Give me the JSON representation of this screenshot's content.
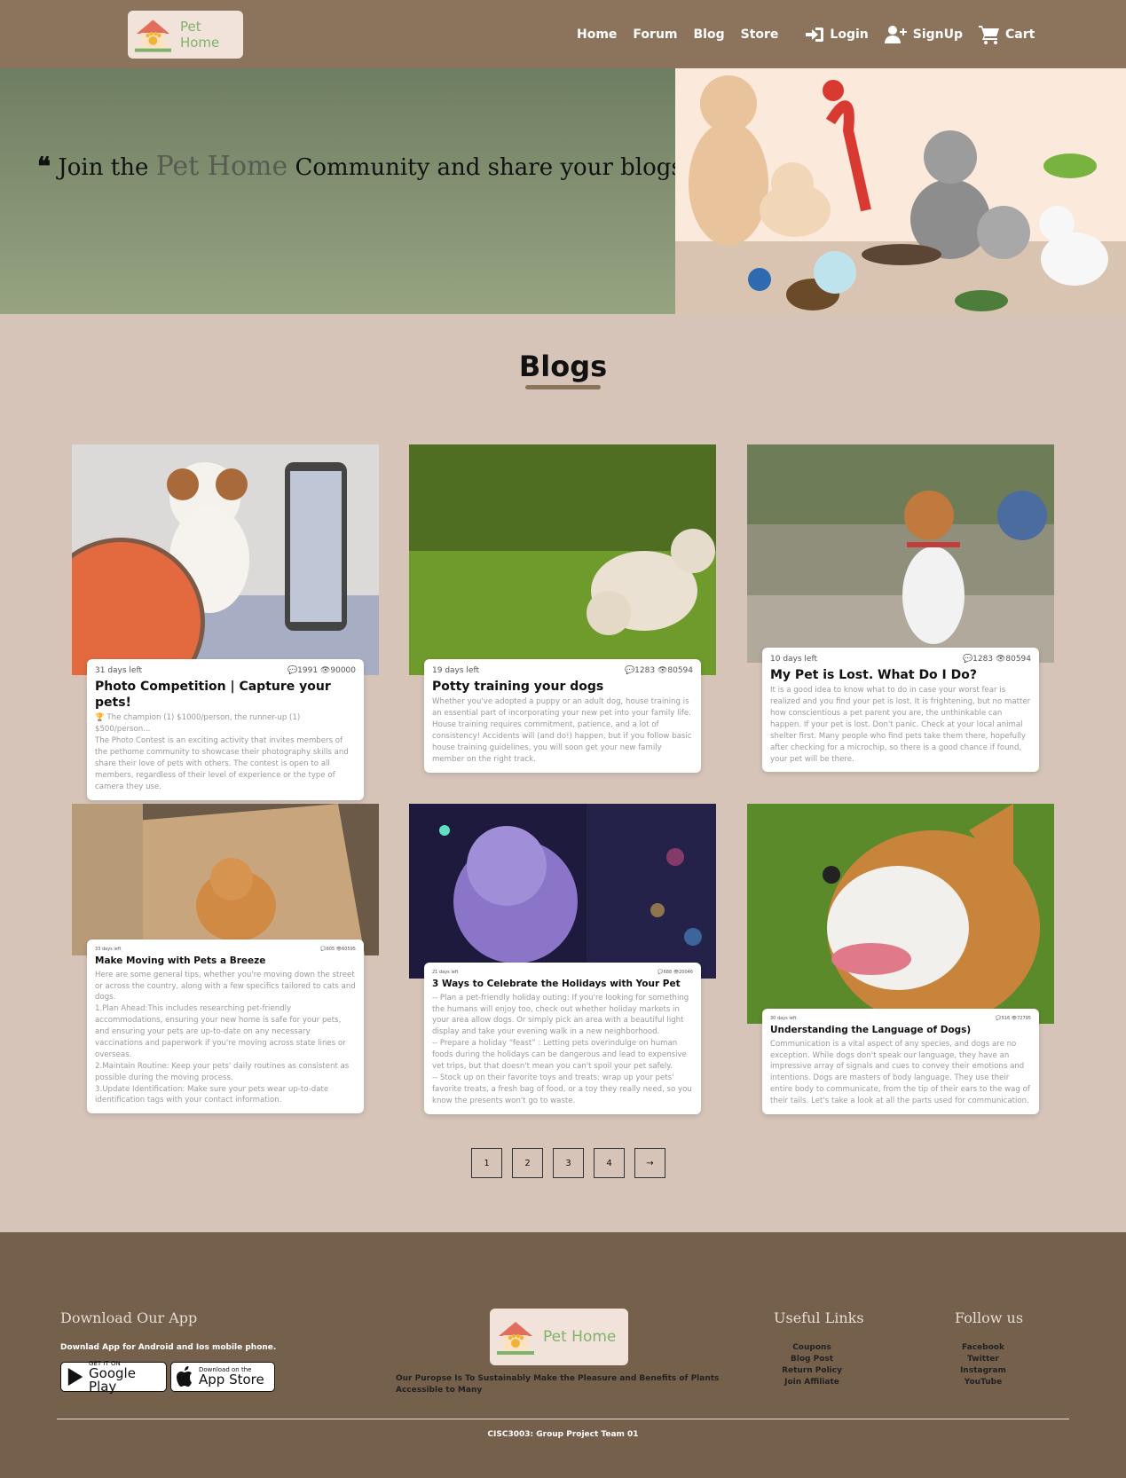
{
  "brand": {
    "logo_text": "Pet Home"
  },
  "nav": {
    "home": "Home",
    "forum": "Forum",
    "blog": "Blog",
    "store": "Store",
    "login": "Login",
    "signup": "SignUp",
    "cart": "Cart"
  },
  "hero": {
    "quote_open": "❝",
    "quote_before": "Join the",
    "quote_accent": "Pet Home",
    "quote_after": "Community and share your blogs",
    "quote_close": "❞"
  },
  "blogs": {
    "title": "Blogs",
    "cards": [
      {
        "days": "31 days left",
        "stats": "💬1991 👁90000",
        "title": "Photo Competition | Capture your pets!",
        "text": "🏆 The champion (1) $1000/person, the runner-up (1) $500/person...\nThe Photo Contest is an exciting activity that invites members of the pethome community to showcase their photography skills and share their love of pets with others. The contest is open to all members, regardless of their level of experience or the type of camera they use."
      },
      {
        "days": "19 days left",
        "stats": "💬1283 👁80594",
        "title": "Potty training your dogs",
        "text": "Whether you've adopted a puppy or an adult dog, house training is an essential part of incorporating your new pet into your family life. House training requires commitment, patience, and a lot of consistency! Accidents will (and do!) happen, but if you follow basic house training guidelines, you will soon get your new family member on the right track."
      },
      {
        "days": "10 days left",
        "stats": "💬1283 👁80594",
        "title": "My Pet is Lost. What Do I Do?",
        "text": "It is a good idea to know what to do in case your worst fear is realized and you find your pet is lost. It is frightening, but no matter how conscientious a pet parent you are, the unthinkable can happen. If your pet is lost. Don't panic. Check at your local animal shelter first. Many people who find pets take them there, hopefully after checking for a microchip, so there is a good chance if found, your pet will be there."
      },
      {
        "days": "33 days left",
        "stats": "💬605 👁60595",
        "title": "Make Moving with Pets a Breeze",
        "text": "Here are some general tips, whether you're moving down the street or across the country, along with a few specifics tailored to cats and dogs.\n1.Plan Ahead:This includes researching pet-friendly accommodations, ensuring your new home is safe for your pets, and ensuring your pets are up-to-date on any necessary vaccinations and paperwork if you're moving across state lines or overseas.\n2.Maintain Routine: Keep your pets' daily routines as consistent as possible during the moving process.\n3.Update Identification: Make sure your pets wear up-to-date identification tags with your contact information."
      },
      {
        "days": "21 days left",
        "stats": "💬688 👁20046",
        "title": "3 Ways to Celebrate the Holidays with Your Pet",
        "text": "-- Plan a pet-friendly holiday outing: If you're looking for something the humans will enjoy too, check out whether holiday markets in your area allow dogs. Or simply pick an area with a beautiful light display and take your evening walk in a new neighborhood.\n-- Prepare a holiday “feast” : Letting pets overindulge on human foods during the holidays can be dangerous and lead to expensive vet trips, but that doesn't mean you can't spoil your pet safely.\n-- Stock up on their favorite toys and treats: wrap up your pets' favorite treats, a fresh bag of food, or a toy they really need, so you know the presents won't go to waste."
      },
      {
        "days": "30 days left",
        "stats": "💬516 👁72795",
        "title": "Understanding the Language of Dogs)",
        "text": "Communication is a vital aspect of any species, and dogs are no exception. While dogs don't speak our language, they have an impressive array of signals and cues to convey their emotions and intentions. Dogs are masters of body language. They use their entire body to communicate, from the tip of their ears to the wag of their tails. Let's take a look at all the parts used for communication."
      }
    ]
  },
  "pager": {
    "p1": "1",
    "p2": "2",
    "p3": "3",
    "p4": "4",
    "next": "→"
  },
  "footer": {
    "app_heading": "Download Our App",
    "app_text": "Downlad App for Android and Ios mobile phone.",
    "google_small": "GET IT ON",
    "google_big": "Google Play",
    "apple_small": "Download on the",
    "apple_big": "App Store",
    "purpose": "Our Puropse Is To Sustainably Make the Pleasure and Benefits of Plants Accessible to Many",
    "useful_heading": "Useful Links",
    "useful_links": [
      "Coupons",
      "Blog Post",
      "Return Policy",
      "Join Affiliate"
    ],
    "follow_heading": "Follow us",
    "follow_links": [
      "Facebook",
      "Twitter",
      "Instagram",
      "YouTube"
    ],
    "copyright": "CISC3003: Group Project Team 01"
  }
}
